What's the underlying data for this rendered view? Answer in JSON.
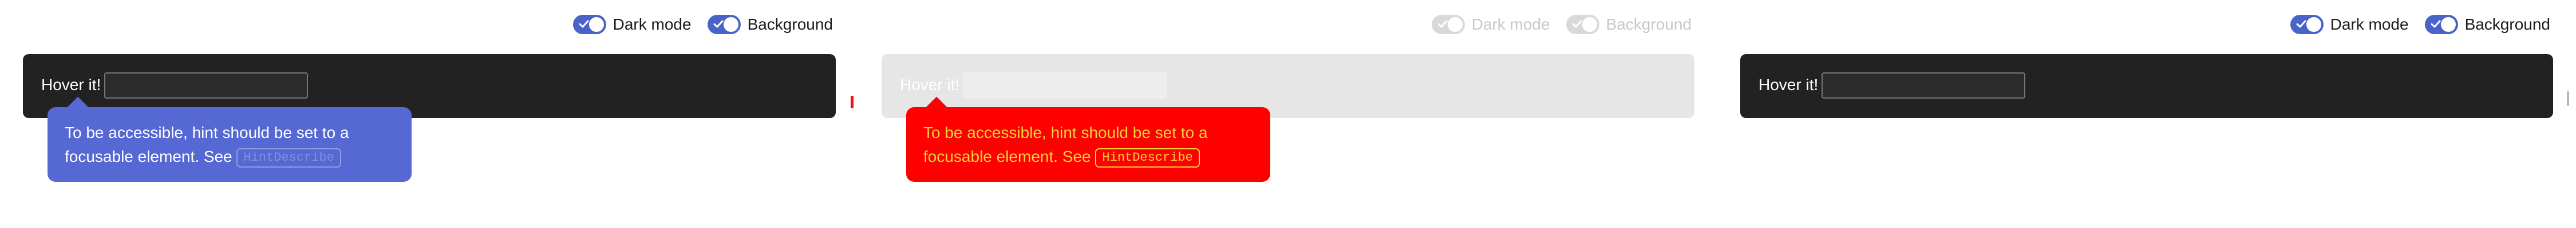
{
  "panels": [
    {
      "id": "dark",
      "toggles": [
        {
          "label": "Dark mode",
          "checked": true
        },
        {
          "label": "Background",
          "checked": true
        }
      ],
      "hover_text": "Hover it!",
      "input_value": "",
      "hint": {
        "text": "To be accessible, hint should be set to a focusable element. See ",
        "code": "HintDescribe"
      }
    },
    {
      "id": "light-highlight",
      "toggles": [
        {
          "label": "Dark mode",
          "checked": false
        },
        {
          "label": "Background",
          "checked": false
        }
      ],
      "hover_text": "Hover it!",
      "input_value": "",
      "hint": {
        "text": "To be accessible, hint should be set to a focusable element. See ",
        "code": "HintDescribe"
      }
    },
    {
      "id": "dark-plain",
      "toggles": [
        {
          "label": "Dark mode",
          "checked": true
        },
        {
          "label": "Background",
          "checked": true
        }
      ],
      "hover_text": "Hover it!",
      "input_value": ""
    }
  ],
  "colors": {
    "accent": "#4a63c8",
    "bar_dark": "#222222",
    "hint_blue": "#5568d3",
    "hint_red": "#ff0000",
    "hint_yellow_text": "#f5d235"
  }
}
